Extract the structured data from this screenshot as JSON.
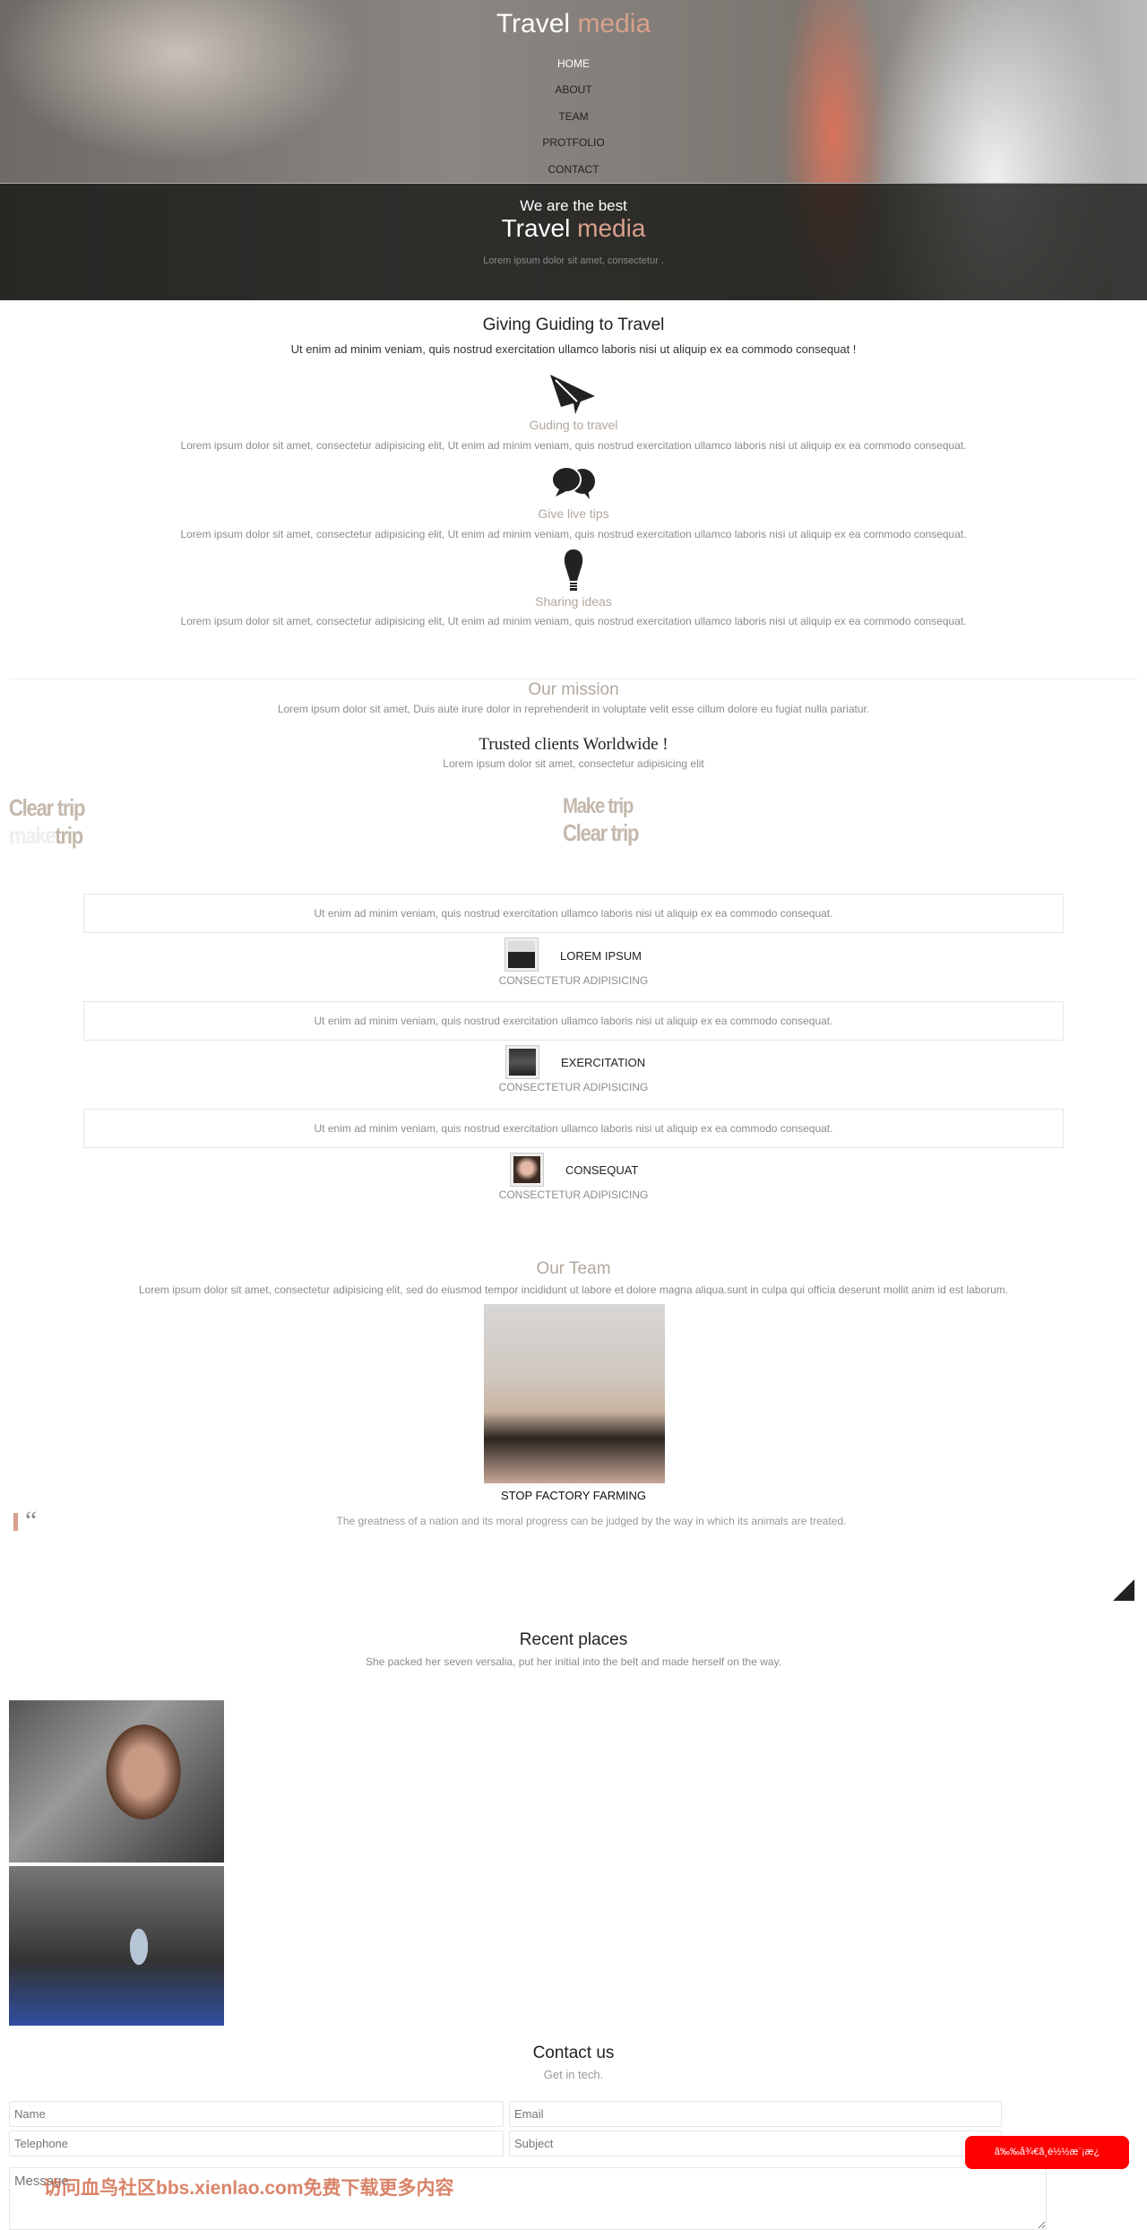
{
  "header": {
    "logo_a": "Travel",
    "logo_b": "media",
    "nav": [
      "HOME",
      "ABOUT",
      "TEAM",
      "PROTFOLIO",
      "CONTACT"
    ],
    "tagline": "We are the best",
    "hero_a": "Travel",
    "hero_b": "media",
    "hero_text": "Lorem ipsum dolor sit amet, consectetur ."
  },
  "guide": {
    "title": "Giving Guiding to Travel",
    "subtitle": "Ut enim ad minim veniam, quis nostrud exercitation ullamco laboris nisi ut aliquip ex ea commodo consequat !",
    "features": [
      {
        "icon": "paper-plane-icon",
        "title": "Guding to travel",
        "text": "Lorem ipsum dolor sit amet, consectetur adipisicing elit, Ut enim ad minim veniam, quis nostrud exercitation ullamco laboris nisi ut aliquip ex ea commodo consequat."
      },
      {
        "icon": "chat-bubbles-icon",
        "title": "Give live tips",
        "text": "Lorem ipsum dolor sit amet, consectetur adipisicing elit, Ut enim ad minim veniam, quis nostrud exercitation ullamco laboris nisi ut aliquip ex ea commodo consequat."
      },
      {
        "icon": "lightbulb-icon",
        "title": "Sharing ideas",
        "text": "Lorem ipsum dolor sit amet, consectetur adipisicing elit, Ut enim ad minim veniam, quis nostrud exercitation ullamco laboris nisi ut aliquip ex ea commodo consequat."
      }
    ]
  },
  "mission": {
    "title": "Our mission",
    "text": "Lorem ipsum dolor sit amet, Duis aute irure dolor in reprehenderit in voluptate velit esse cillum dolore eu fugiat nulla pariatur."
  },
  "clients": {
    "title": "Trusted clients Worldwide !",
    "text": "Lorem ipsum dolor sit amet, consectetur adipisicing elit",
    "logos": [
      {
        "line1": "Clear trip",
        "line2a": "make",
        "line2b": "trip"
      },
      {
        "line1": "Make trip",
        "line2": "Clear trip"
      }
    ]
  },
  "testimonials": [
    {
      "quote": "Ut enim ad minim veniam, quis nostrud exercitation ullamco laboris nisi ut aliquip ex ea commodo consequat.",
      "name": "LOREM IPSUM",
      "role": "CONSECTETUR ADIPISICING"
    },
    {
      "quote": "Ut enim ad minim veniam, quis nostrud exercitation ullamco laboris nisi ut aliquip ex ea commodo consequat.",
      "name": "EXERCITATION",
      "role": "CONSECTETUR ADIPISICING"
    },
    {
      "quote": "Ut enim ad minim veniam, quis nostrud exercitation ullamco laboris nisi ut aliquip ex ea commodo consequat.",
      "name": "CONSEQUAT",
      "role": "CONSECTETUR ADIPISICING"
    }
  ],
  "team": {
    "title": "Our Team",
    "text": "Lorem ipsum dolor sit amet, consectetur adipisicing elit, sed do eiusmod tempor incididunt ut labore et dolore magna aliqua.sunt in culpa qui officia deserunt mollit anim id est laborum.",
    "caption": "STOP FACTORY FARMING",
    "quote_mark": "“",
    "quote": "The greatness of a nation and its moral progress can be judged by the way in which its animals are treated."
  },
  "places": {
    "title": "Recent places",
    "text": "She packed her seven versalia, put her initial into the belt and made herself on the way."
  },
  "contact": {
    "title": "Contact us",
    "subtitle": "Get in tech.",
    "name_ph": "Name",
    "email_ph": "Email",
    "tel_ph": "Telephone",
    "subject_ph": "Subject",
    "message_ph": "Message",
    "float_button": "ã‰‰å¾€ã¸­è½½æ¨¡æ¿",
    "watermark": "访问血鸟社区bbs.xienlao.com免费下载更多内容"
  },
  "colors": {
    "accent": "#d8a08c",
    "muted_brown": "#b2a89e",
    "float_button": "#ff0000"
  }
}
